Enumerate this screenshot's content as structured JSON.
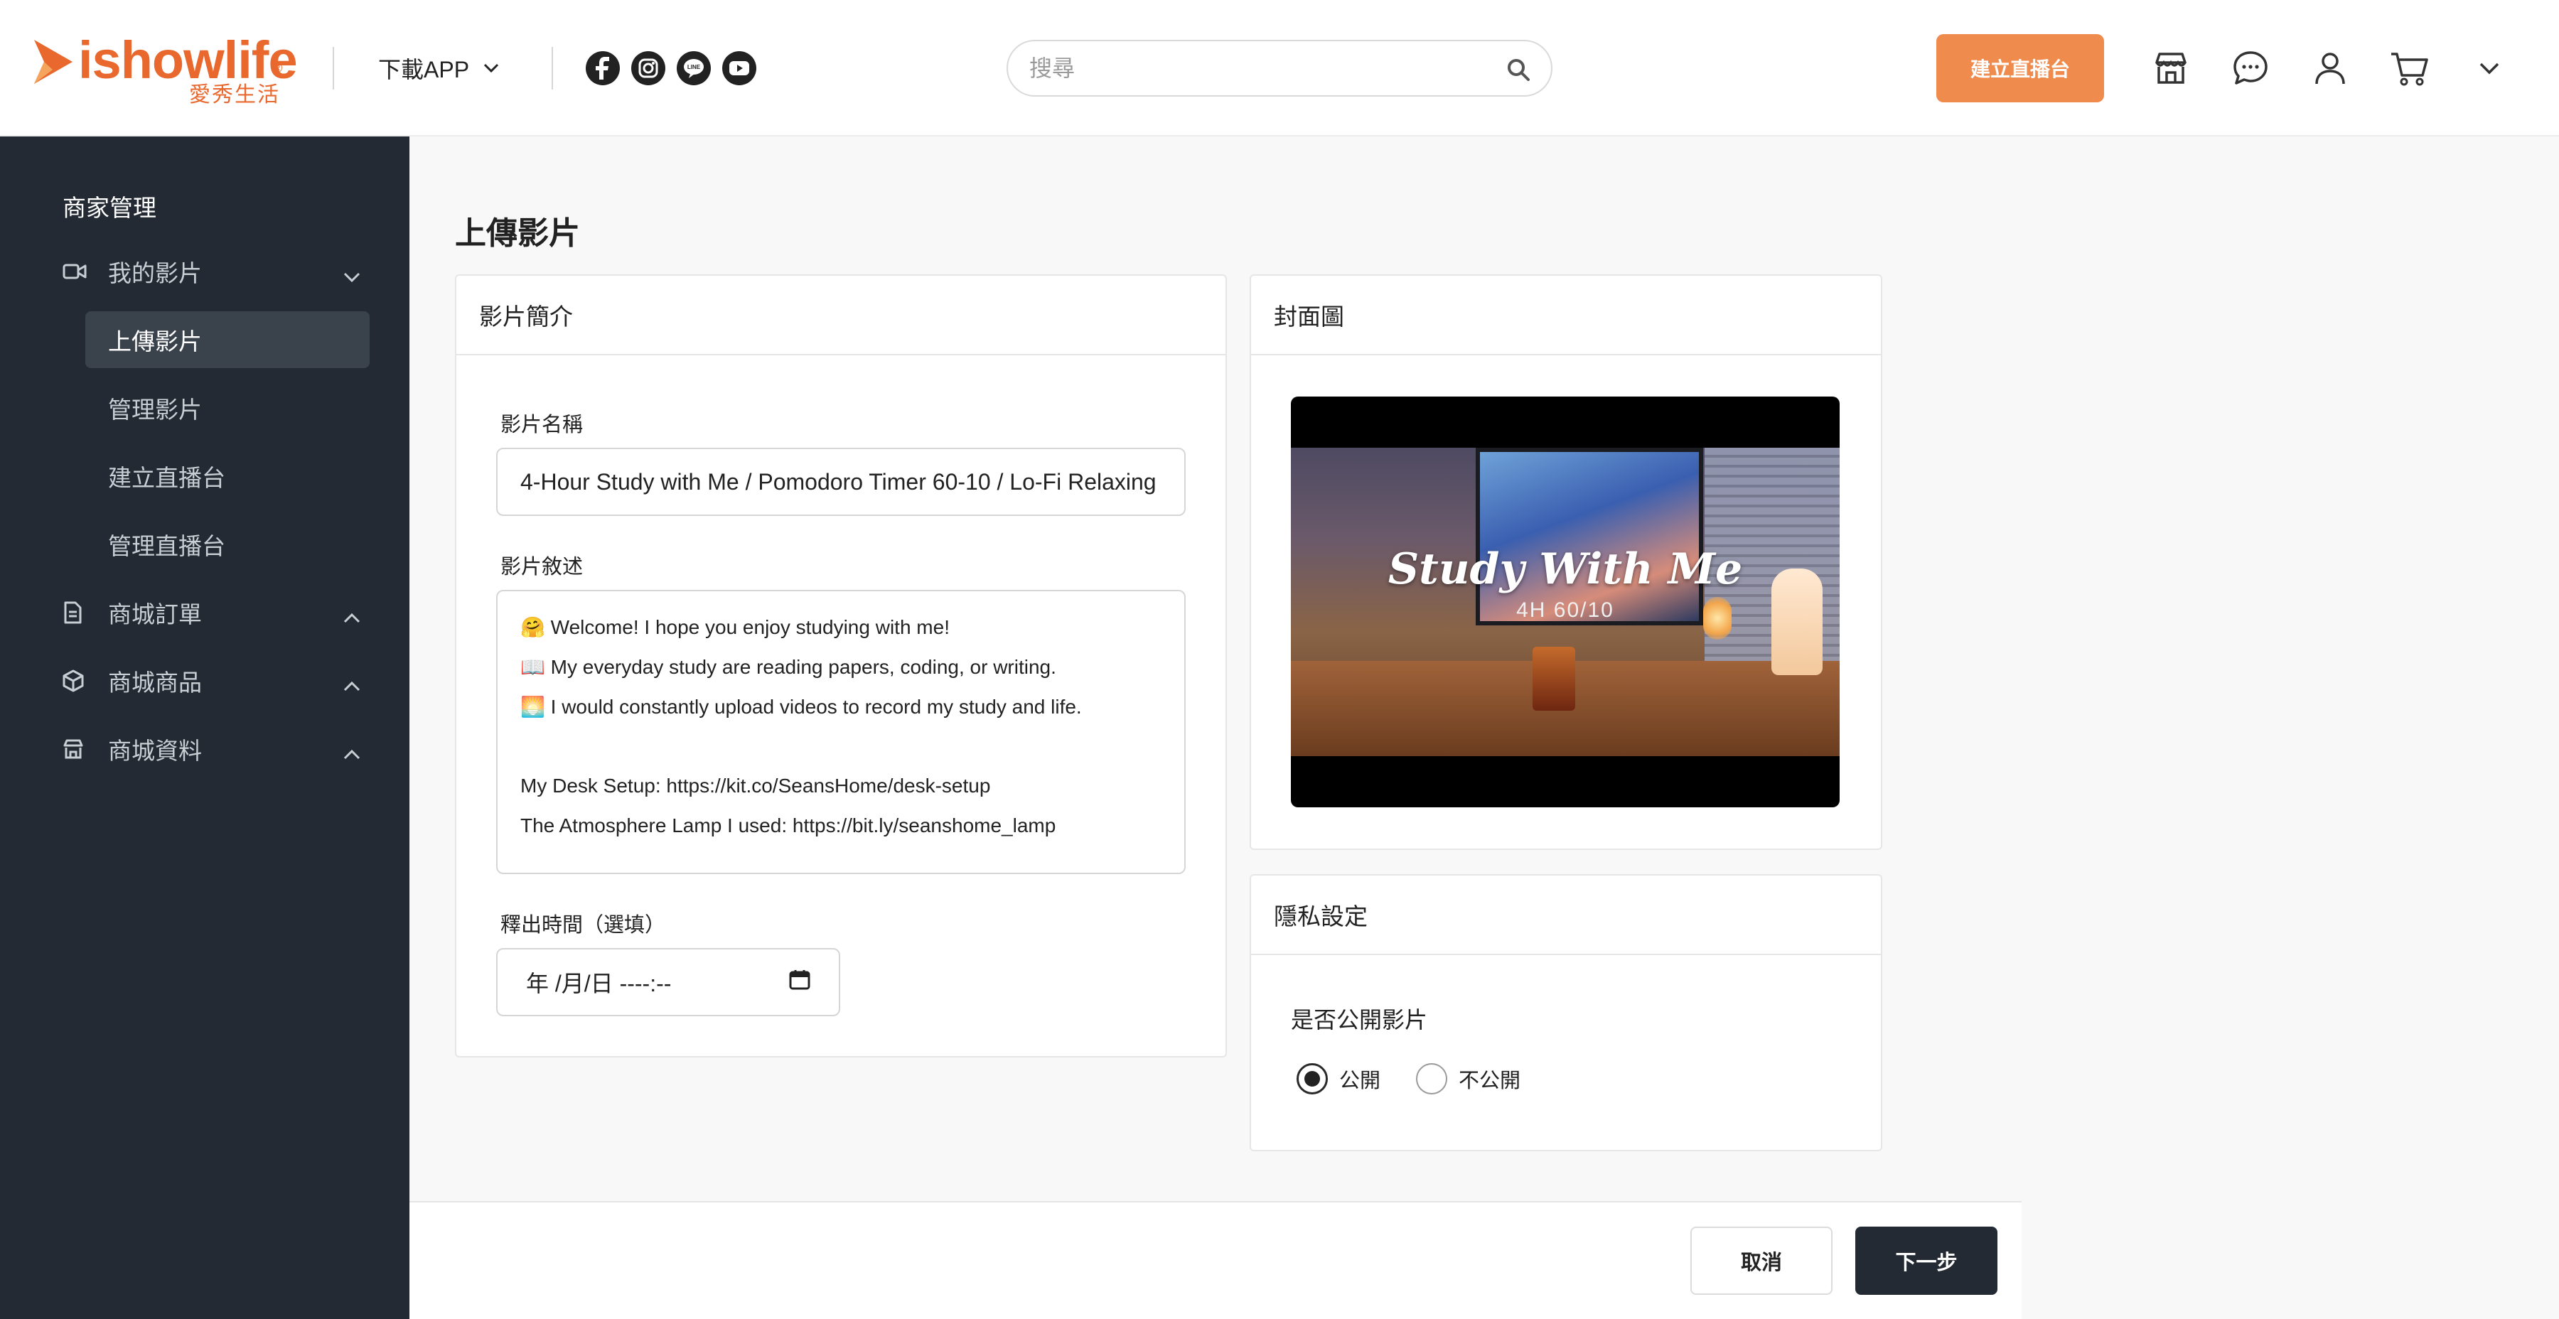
{
  "header": {
    "logo_text": "ishowlife",
    "logo_reg": "®",
    "logo_sub": "愛秀生活",
    "download_label": "下載APP",
    "socials": [
      "facebook-icon",
      "instagram-icon",
      "line-icon",
      "youtube-icon"
    ],
    "search_placeholder": "搜尋",
    "search_value": "",
    "create_live_label": "建立直播台",
    "icons": [
      "store-icon",
      "chat-icon",
      "user-icon",
      "cart-icon",
      "chevron-down-icon"
    ],
    "brand_color": "#e8682d",
    "accent_button_color": "#ef8b4c"
  },
  "sidebar": {
    "title": "商家管理",
    "groups": [
      {
        "label": "我的影片",
        "icon": "video-icon",
        "expanded": true
      },
      {
        "label": "商城訂單",
        "icon": "document-icon",
        "expanded": false
      },
      {
        "label": "商城商品",
        "icon": "box-icon",
        "expanded": false
      },
      {
        "label": "商城資料",
        "icon": "shop-icon",
        "expanded": false
      }
    ],
    "sub_items": [
      {
        "label": "上傳影片",
        "active": true
      },
      {
        "label": "管理影片",
        "active": false
      },
      {
        "label": "建立直播台",
        "active": false
      },
      {
        "label": "管理直播台",
        "active": false
      }
    ],
    "background_color": "#232a33"
  },
  "main": {
    "page_title": "上傳影片",
    "intro_card": {
      "heading": "影片簡介",
      "name_label": "影片名稱",
      "name_value": "4-Hour Study with Me / Pomodoro Timer 60-10 / Lo-Fi Relaxing",
      "desc_label": "影片敘述",
      "desc_lines": [
        "🤗 Welcome! I hope you enjoy studying with me!",
        "📖 My everyday study are reading papers, coding, or writing.",
        "🌅 I would constantly upload videos to record my study and life.",
        "",
        "My Desk Setup: https://kit.co/SeansHome/desk-setup",
        "The Atmosphere Lamp I used: https://bit.ly/seanshome_lamp"
      ],
      "release_label": "釋出時間（選填）",
      "release_placeholder": "年 /月/日 ----:--"
    },
    "cover_card": {
      "heading": "封面圖",
      "cover_title": "Study With Me",
      "cover_subtitle": "4H 60/10"
    },
    "privacy_card": {
      "heading": "隱私設定",
      "question": "是否公開影片",
      "options": [
        {
          "label": "公開",
          "checked": true
        },
        {
          "label": "不公開",
          "checked": false
        }
      ]
    }
  },
  "footer": {
    "cancel_label": "取消",
    "next_label": "下一步"
  }
}
